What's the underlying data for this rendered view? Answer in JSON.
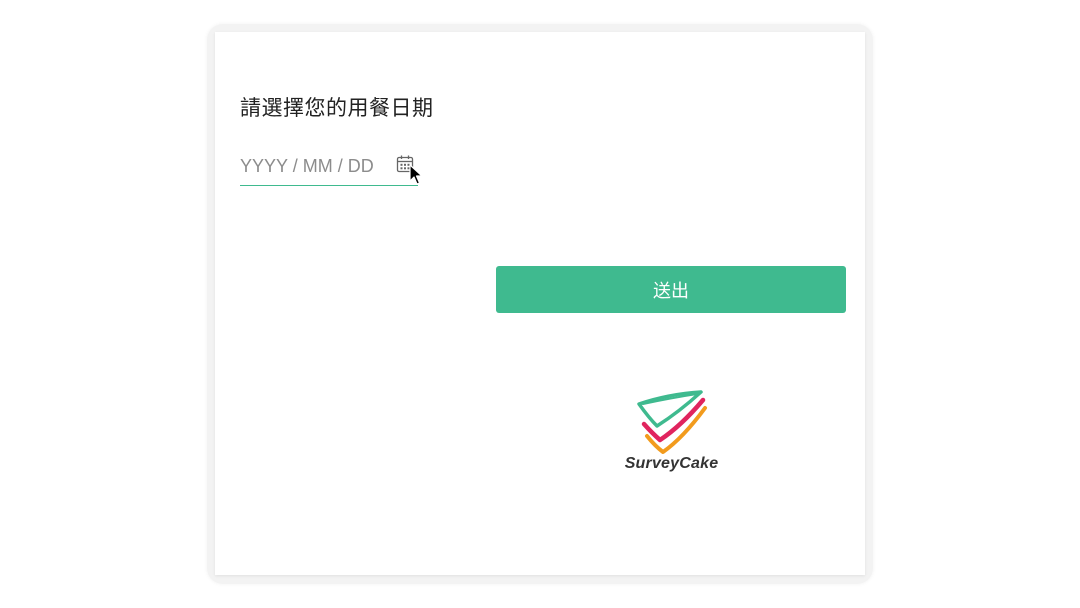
{
  "form": {
    "question_title": "請選擇您的用餐日期",
    "date_input": {
      "value": "",
      "placeholder": "YYYY / MM / DD"
    },
    "submit_label": "送出"
  },
  "branding": {
    "name": "SurveyCake"
  },
  "icons": {
    "calendar": "calendar-icon",
    "cursor": "mouse-pointer-icon",
    "logo": "surveycake-logo-icon"
  },
  "colors": {
    "accent": "#3fba8f",
    "logo_green": "#3fba8f",
    "logo_red": "#e0245e",
    "logo_orange": "#f29b1d",
    "text": "#222222",
    "placeholder": "#8c8c8c"
  }
}
